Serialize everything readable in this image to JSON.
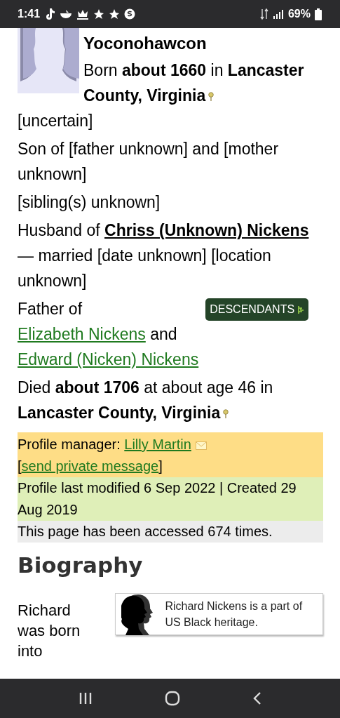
{
  "status_bar": {
    "time": "1:41",
    "battery": "69%"
  },
  "profile": {
    "name": "Yoconohawcon",
    "birth": [
      {
        "kind": "text",
        "text": "Born "
      },
      {
        "kind": "bold",
        "text": "about 1660"
      },
      {
        "kind": "text",
        "text": " in "
      },
      {
        "kind": "place",
        "text": "Lancaster County, Virginia"
      }
    ],
    "paragraphs": [
      [
        {
          "kind": "text",
          "text": "[uncertain]"
        }
      ],
      [
        {
          "kind": "text",
          "text": "Son of [father unknown] and [mother unknown]"
        }
      ],
      [
        {
          "kind": "text",
          "text": "[sibling(s) unknown]"
        }
      ],
      [
        {
          "kind": "text",
          "text": "Husband of "
        },
        {
          "kind": "bold_link",
          "text": "Chriss (Unknown) Nickens"
        },
        {
          "kind": "text",
          "text": " — married [date unknown] [location unknown]"
        }
      ],
      [
        {
          "kind": "text",
          "text": "Father of "
        },
        {
          "kind": "button",
          "text": "DESCENDANTS"
        },
        {
          "kind": "link",
          "text": "Elizabeth Nickens"
        },
        {
          "kind": "text",
          "text": " and "
        },
        {
          "kind": "link",
          "text": "Edward (Nicken) Nickens"
        }
      ],
      [
        {
          "kind": "text",
          "text": "Died "
        },
        {
          "kind": "bold",
          "text": "about 1706"
        },
        {
          "kind": "text",
          "text": " at about age 46 in "
        },
        {
          "kind": "place",
          "text": "Lancaster County, Virginia"
        }
      ]
    ]
  },
  "info_boxes": [
    {
      "kind": "manager",
      "segments": [
        {
          "kind": "text",
          "text": "Profile manager: "
        },
        {
          "kind": "link",
          "text": "Lilly Martin"
        },
        {
          "kind": "mail",
          "text": " ["
        },
        {
          "kind": "link",
          "text": "send private message"
        },
        {
          "kind": "text",
          "text": "]"
        }
      ]
    },
    {
      "kind": "modified",
      "segments": [
        {
          "kind": "text",
          "text": "Profile last modified 6 Sep 2022 | Created 29 Aug 2019"
        }
      ]
    },
    {
      "kind": "accessed",
      "segments": [
        {
          "kind": "text",
          "text": "This page has been accessed 674 times."
        }
      ]
    }
  ],
  "biography": {
    "heading": "Biography",
    "text": "Richard was born into",
    "heritage_note": "Richard Nickens is a part of US Black heritage."
  }
}
